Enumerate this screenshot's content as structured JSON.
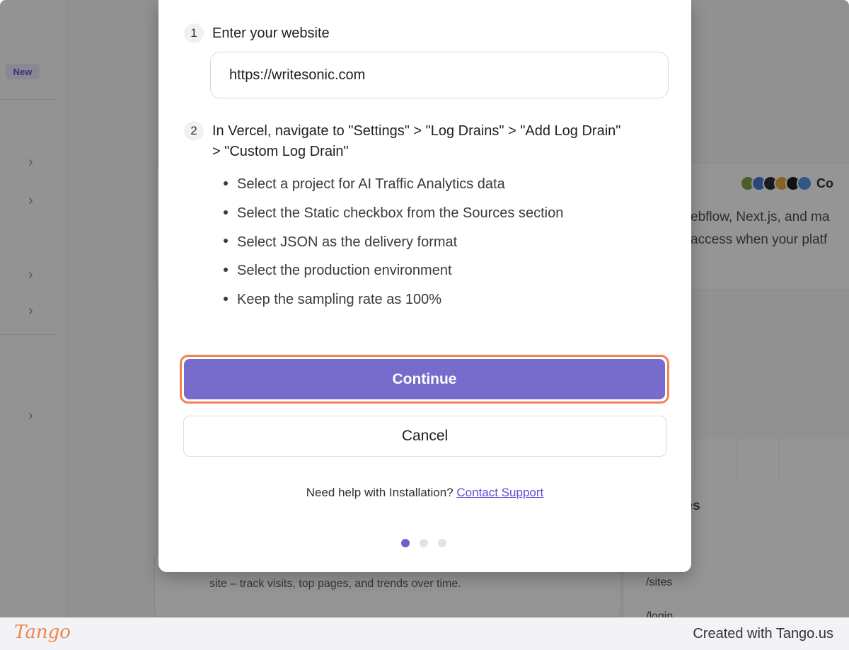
{
  "background_app": {
    "new_badge": "New",
    "hero_text_line1": "ebflow, Next.js, and ma",
    "hero_text_line2": "access when your platf",
    "logos_label": "Co",
    "table_header": "ges",
    "table_rows": [
      "/sites",
      "/login"
    ],
    "bottom_text": "site – track visits, top pages, and trends over time.",
    "icons": [
      "chevron-right",
      "chevron-right",
      "chevron-right",
      "chevron-right",
      "chevron-right"
    ]
  },
  "modal": {
    "step1": {
      "number": "1",
      "title": "Enter your website"
    },
    "website_input": {
      "value": "https://writesonic.com"
    },
    "step2": {
      "number": "2",
      "title_line1": "In Vercel, navigate to \"Settings\" > \"Log Drains\" > \"Add Log Drain\"",
      "title_line2": "> \"Custom Log Drain\"",
      "bullets": [
        "Select a project for AI Traffic Analytics data",
        "Select the Static checkbox from the Sources section",
        "Select JSON as the delivery format",
        "Select the production environment",
        "Keep the sampling rate as 100%"
      ]
    },
    "continue_label": "Continue",
    "cancel_label": "Cancel",
    "help_text": "Need help with Installation?",
    "help_link": "Contact Support",
    "pagination": {
      "current": 1,
      "total": 3
    }
  },
  "footer": {
    "brand": "Tango",
    "created_with": "Created with Tango.us"
  },
  "colors": {
    "primary": "#776bcb",
    "highlight": "#f08450",
    "link": "#5b4fd6"
  }
}
